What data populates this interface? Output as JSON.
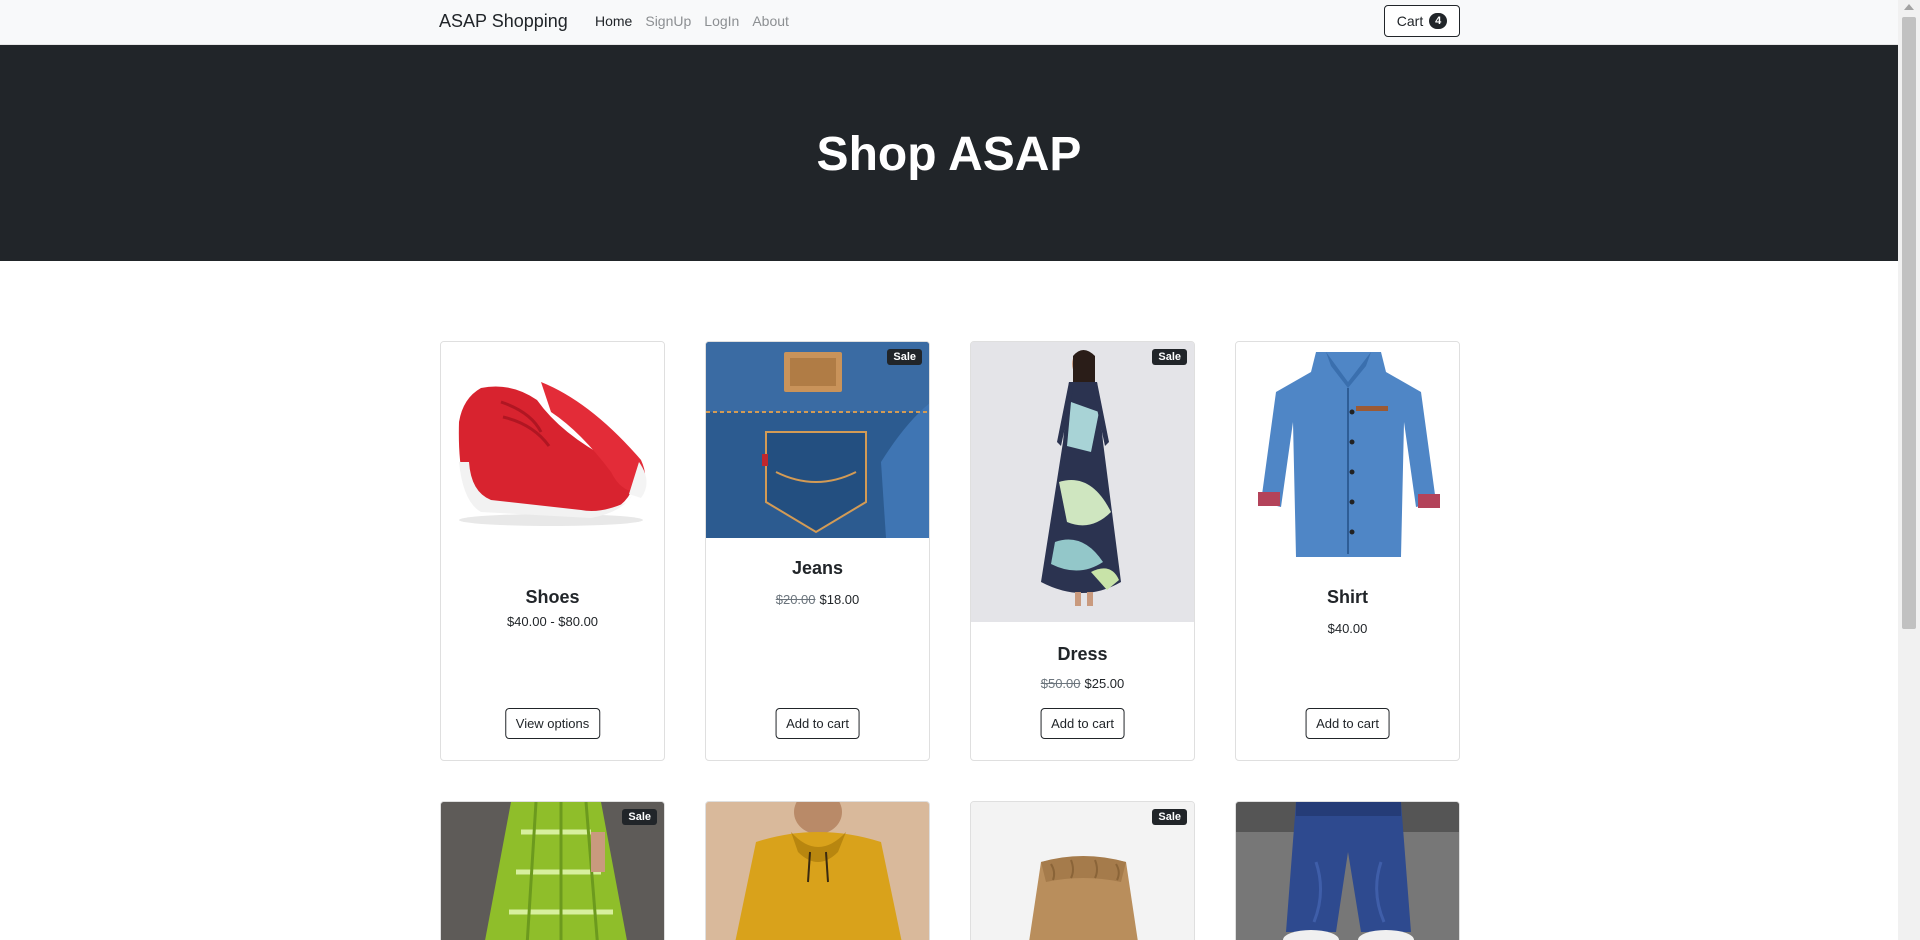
{
  "navbar": {
    "brand": "ASAP Shopping",
    "links": [
      "Home",
      "SignUp",
      "LogIn",
      "About"
    ],
    "cart_label": "Cart",
    "cart_count": "4"
  },
  "hero": {
    "title": "Shop ASAP"
  },
  "products": [
    {
      "title": "Shoes",
      "price": "$40.00 - $80.00",
      "button": "View options",
      "sale": false
    },
    {
      "title": "Jeans",
      "old_price": "$20.00",
      "price": "$18.00",
      "button": "Add to cart",
      "sale": true,
      "sale_label": "Sale"
    },
    {
      "title": "Dress",
      "old_price": "$50.00",
      "price": "$25.00",
      "button": "Add to cart",
      "sale": true,
      "sale_label": "Sale"
    },
    {
      "title": "Shirt",
      "price": "$40.00",
      "button": "Add to cart",
      "sale": false
    },
    {
      "sale": true,
      "sale_label": "Sale"
    },
    {
      "sale": false
    },
    {
      "sale": true,
      "sale_label": "Sale"
    },
    {
      "sale": false
    }
  ],
  "colors": {
    "dark": "#212529",
    "nav_bg": "#f8f9fa",
    "muted": "#8c8f92"
  }
}
